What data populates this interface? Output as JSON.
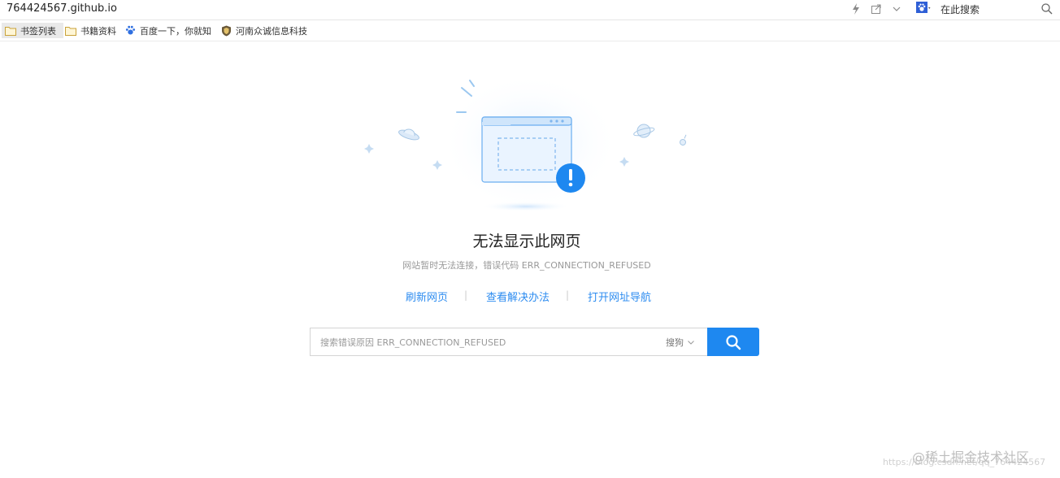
{
  "address_bar": {
    "url": "764424567.github.io",
    "search_placeholder": "在此搜索",
    "icons": [
      "lightning-icon",
      "share-icon",
      "chevron-down-icon",
      "paw-icon",
      "search-icon"
    ]
  },
  "bookmarks": [
    {
      "label": "书签列表",
      "icon": "folder-icon"
    },
    {
      "label": "书籍资料",
      "icon": "folder-icon"
    },
    {
      "label": "百度一下，你就知",
      "icon": "paw-icon"
    },
    {
      "label": "河南众诚信息科技",
      "icon": "shield-icon"
    }
  ],
  "error": {
    "title": "无法显示此网页",
    "description": "网站暂时无法连接，错误代码 ERR_CONNECTION_REFUSED"
  },
  "actions": {
    "refresh": "刷新网页",
    "solutions": "查看解决办法",
    "navigation": "打开网址导航",
    "separator": "|"
  },
  "search": {
    "placeholder": "搜索错误原因 ERR_CONNECTION_REFUSED",
    "engine": "搜狗"
  },
  "watermark": {
    "brand": "@稀土掘金技术社区",
    "url": "https://blog.csdn.net/qq_764424567"
  },
  "colors": {
    "accent": "#1e88f0",
    "link": "#2d8cf0",
    "illustration_light": "#dfefff",
    "illustration_stroke": "#5aaaf2"
  }
}
